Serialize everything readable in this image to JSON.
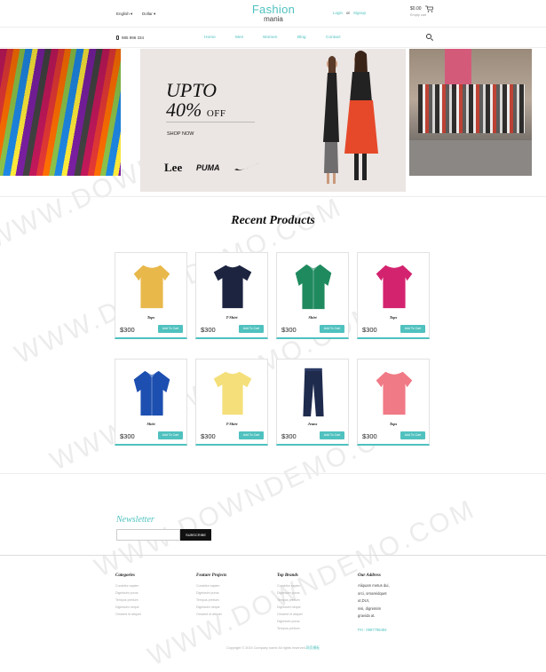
{
  "header": {
    "language": "English",
    "currency": "Dollar",
    "logo_line1": "Fashion",
    "logo_line2": "mania",
    "login": "Login",
    "or": "or",
    "signup": "Signup",
    "cart_amount": "$0.00",
    "cart_items": "Empty cart"
  },
  "navbar": {
    "phone": "985 996 334",
    "links": [
      "Home",
      "Men",
      "Women",
      "Blog",
      "Contact"
    ]
  },
  "hero": {
    "headline1": "UPTO",
    "headline2_num": "40%",
    "headline2_off": "OFF",
    "cta": "SHOP NOW",
    "brands": [
      "Lee",
      "PUMA"
    ],
    "active_slide": 1,
    "slide_count": 3
  },
  "products": {
    "title": "Recent Products",
    "items": [
      {
        "name": "Tops",
        "price": "$300",
        "button": "Add To Cart",
        "icon": "yellow-top",
        "color": "#e8b84a"
      },
      {
        "name": "T-Shirt",
        "price": "$300",
        "button": "Add To Cart",
        "icon": "navy-tshirt",
        "color": "#1c2440"
      },
      {
        "name": "Shirt",
        "price": "$300",
        "button": "Add To Cart",
        "icon": "green-shirt",
        "color": "#1f8a5e"
      },
      {
        "name": "Tops",
        "price": "$300",
        "button": "Add To Cart",
        "icon": "pink-top",
        "color": "#d3236f"
      },
      {
        "name": "Shirt",
        "price": "$300",
        "button": "Add To Cart",
        "icon": "blue-shirt",
        "color": "#1d4fb0"
      },
      {
        "name": "T-Shirt",
        "price": "$300",
        "button": "Add To Cart",
        "icon": "yellow-tshirt",
        "color": "#f4df7a"
      },
      {
        "name": "Jeans",
        "price": "$300",
        "button": "Add To Cart",
        "icon": "jeans",
        "color": "#1e2b4d"
      },
      {
        "name": "Tops",
        "price": "$300",
        "button": "Add To Cart",
        "icon": "coral-top",
        "color": "#f07a86"
      }
    ]
  },
  "newsletter": {
    "title": "Newsletter",
    "placeholder": "",
    "button": "SUBSCRIBE"
  },
  "footer": {
    "columns": [
      {
        "heading": "Categories",
        "links": [
          "Curabitur sapien",
          "Dignissim purus",
          "Tempus pretium",
          "Dignissim neque",
          "Ornared id aliquet"
        ]
      },
      {
        "heading": "Feature Projects",
        "links": [
          "Curabitur sapien",
          "Dignissim purus",
          "Tempus pretium",
          "Dignissim neque",
          "Ornared id aliquet"
        ]
      },
      {
        "heading": "Top Brands",
        "links": [
          "Curabitur sapien",
          "Dignissim purus",
          "Tempus pretium",
          "Dignissim neque",
          "Ornared id aliquet",
          "Dignissim purus",
          "Tempus pretium"
        ]
      }
    ],
    "address": {
      "heading": "Our Address",
      "lines": [
        "Aliquam metus dui,",
        "orci, ornareidquet",
        "ut,DUI,",
        "nisi, dignissim",
        "gravida at."
      ],
      "phone": "PH : 0987796484"
    },
    "copyright": "Copyright © 2015 Company name All rights reserved.",
    "copyright_link": "网页模板"
  },
  "watermark": "WWW.DOWNDEMO.COM",
  "colors": {
    "accent": "#4fc1bf",
    "dark": "#111111"
  }
}
